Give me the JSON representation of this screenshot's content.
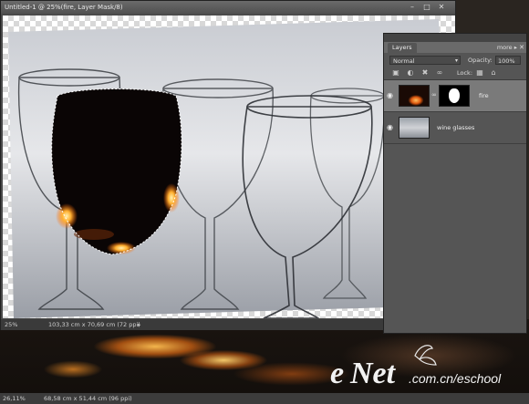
{
  "document": {
    "title": "Untitled-1 @ 25%(fire, Layer Mask/8)",
    "zoom": "25%",
    "dimensions": "103,33 cm x 70,69 cm (72 ppi)"
  },
  "layers_panel": {
    "tab_label": "Layers",
    "more_label": "more ▸",
    "blend_mode": "Normal",
    "opacity_label": "Opacity:",
    "opacity_value": "100%",
    "lock_label": "Lock:",
    "layers": [
      {
        "name": "fire",
        "selected": true,
        "has_mask": true
      },
      {
        "name": "wine glasses",
        "selected": false,
        "has_mask": false
      }
    ]
  },
  "background_window": {
    "zoom": "26,11%",
    "dimensions": "68,58 cm x 51,44 cm (96 ppi)"
  },
  "watermark": {
    "brand": "eNet",
    "domain": ".com.cn/eschool"
  },
  "icons": {
    "close": "close-icon",
    "minimize": "minimize-icon",
    "maximize": "maximize-icon",
    "visibility": "eye-icon",
    "link": "chain-link-icon"
  }
}
